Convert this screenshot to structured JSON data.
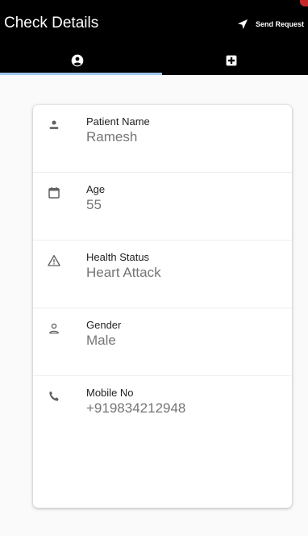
{
  "appbar": {
    "title": "Check Details",
    "send_label": "Send Request",
    "send_icon": "navigation-arrow-icon"
  },
  "tabs": [
    {
      "icon": "account-circle-icon",
      "selected": true
    },
    {
      "icon": "medical-cross-icon",
      "selected": false
    }
  ],
  "colors": {
    "appbar_bg": "#000000",
    "tab_indicator": "#9ec8ee",
    "label_text": "#222222",
    "value_text": "#757575"
  },
  "details": [
    {
      "icon": "person-icon",
      "label": "Patient Name",
      "value": "Ramesh"
    },
    {
      "icon": "calendar-icon",
      "label": "Age",
      "value": "55"
    },
    {
      "icon": "warning-triangle-icon",
      "label": "Health Status",
      "value": "Heart Attack"
    },
    {
      "icon": "person-outline-icon",
      "label": "Gender",
      "value": "Male"
    },
    {
      "icon": "phone-icon",
      "label": "Mobile No",
      "value": "+919834212948"
    }
  ]
}
